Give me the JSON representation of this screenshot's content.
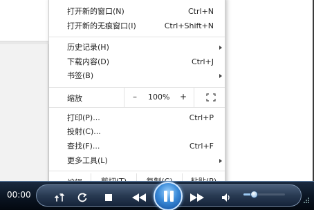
{
  "menu": {
    "items": [
      {
        "label": "打开新的窗口(N)",
        "shortcut": "Ctrl+N"
      },
      {
        "label": "打开新的无痕窗口(I)",
        "shortcut": "Ctrl+Shift+N"
      },
      {
        "label": "历史记录(H)",
        "shortcut": ""
      },
      {
        "label": "下载内容(D)",
        "shortcut": "Ctrl+J"
      },
      {
        "label": "书签(B)",
        "shortcut": ""
      },
      {
        "label": "打印(P)...",
        "shortcut": "Ctrl+P"
      },
      {
        "label": "投射(C)...",
        "shortcut": ""
      },
      {
        "label": "查找(F)...",
        "shortcut": "Ctrl+F"
      },
      {
        "label": "更多工具(L)",
        "shortcut": ""
      }
    ],
    "zoom": {
      "label": "缩放",
      "minus": "–",
      "value": "100%",
      "plus": "+"
    },
    "edit": {
      "label": "编辑",
      "cut": "剪切(T)",
      "copy": "复制(C)",
      "paste": "粘贴(P)"
    }
  },
  "player": {
    "time": "00:00",
    "volume_fraction": 0.25,
    "accent_color": "#3a8ad8"
  }
}
